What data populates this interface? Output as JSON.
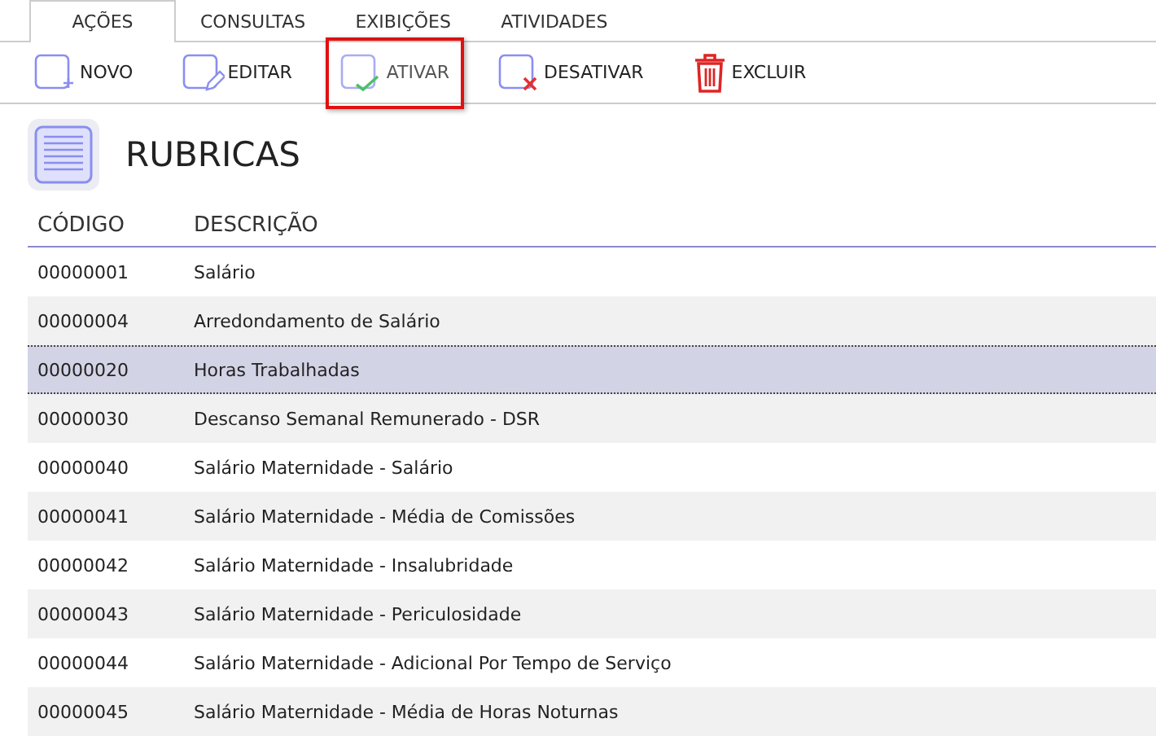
{
  "tabs": [
    {
      "label": "AÇÕES",
      "selected": true
    },
    {
      "label": "CONSULTAS",
      "selected": false
    },
    {
      "label": "EXIBIÇÕES",
      "selected": false
    },
    {
      "label": "ATIVIDADES",
      "selected": false
    }
  ],
  "toolbar": [
    {
      "kind": "new",
      "label": "NOVO",
      "highlighted": false
    },
    {
      "kind": "edit",
      "label": "EDITAR",
      "highlighted": false
    },
    {
      "kind": "activate",
      "label": "ATIVAR",
      "highlighted": true
    },
    {
      "kind": "deactivate",
      "label": "DESATIVAR",
      "highlighted": false
    },
    {
      "kind": "delete",
      "label": "EXCLUIR",
      "highlighted": false
    }
  ],
  "page_title": "RUBRICAS",
  "table": {
    "columns": [
      "CÓDIGO",
      "DESCRIÇÃO"
    ],
    "rows": [
      {
        "code": "00000001",
        "description": "Salário",
        "selected": false
      },
      {
        "code": "00000004",
        "description": "Arredondamento de Salário",
        "selected": false
      },
      {
        "code": "00000020",
        "description": "Horas Trabalhadas",
        "selected": true
      },
      {
        "code": "00000030",
        "description": "Descanso Semanal Remunerado - DSR",
        "selected": false
      },
      {
        "code": "00000040",
        "description": "Salário Maternidade - Salário",
        "selected": false
      },
      {
        "code": "00000041",
        "description": "Salário Maternidade - Média de Comissões",
        "selected": false
      },
      {
        "code": "00000042",
        "description": "Salário Maternidade - Insalubridade",
        "selected": false
      },
      {
        "code": "00000043",
        "description": "Salário Maternidade - Periculosidade",
        "selected": false
      },
      {
        "code": "00000044",
        "description": "Salário Maternidade - Adicional Por Tempo de Serviço",
        "selected": false
      },
      {
        "code": "00000045",
        "description": "Salário Maternidade - Média de Horas Noturnas",
        "selected": false
      }
    ]
  }
}
